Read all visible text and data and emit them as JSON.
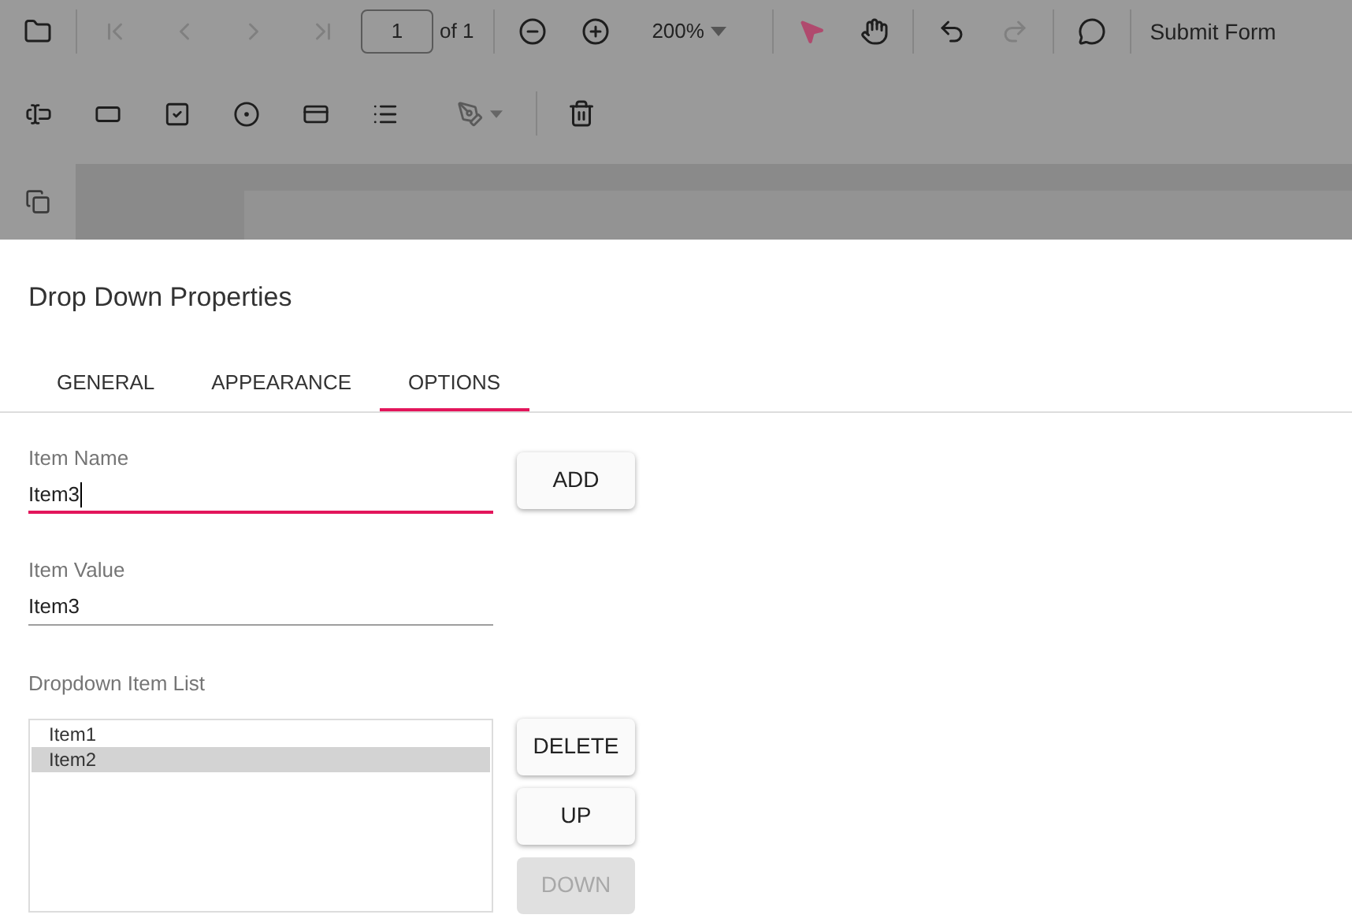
{
  "toolbar": {
    "open": {
      "disabled": false
    },
    "first_page": {
      "disabled": true
    },
    "previous_page": {
      "disabled": true
    },
    "next_page": {
      "disabled": true
    },
    "last_page": {
      "disabled": true
    },
    "page_field": {
      "value": "1"
    },
    "page_count": "of 1",
    "zoom_out": {
      "disabled": false
    },
    "zoom_in": {
      "disabled": false
    },
    "zoom": "200%",
    "select_tool": {
      "selected": true
    },
    "pan_tool": {
      "selected": false
    },
    "undo": {
      "disabled": false
    },
    "redo": {
      "disabled": true
    },
    "comment": {
      "disabled": false
    },
    "submit": "Submit Form"
  },
  "dialog": {
    "title": "Drop Down Properties",
    "tabs": [
      {
        "label": "GENERAL",
        "selected": false
      },
      {
        "label": "APPEARANCE",
        "selected": false
      },
      {
        "label": "OPTIONS",
        "selected": true
      }
    ],
    "item_name": {
      "label": "Item Name",
      "value": "Item3",
      "focused": true
    },
    "item_value": {
      "label": "Item Value",
      "value": "Item3",
      "focused": false
    },
    "add_button": {
      "label": "ADD",
      "disabled": false
    },
    "list_label": "Dropdown Item List",
    "list_items": [
      {
        "label": "Item1",
        "selected": false
      },
      {
        "label": "Item2",
        "selected": true
      }
    ],
    "list_buttons": [
      {
        "label": "DELETE",
        "disabled": false
      },
      {
        "label": "UP",
        "disabled": false
      },
      {
        "label": "DOWN",
        "disabled": true
      }
    ]
  }
}
